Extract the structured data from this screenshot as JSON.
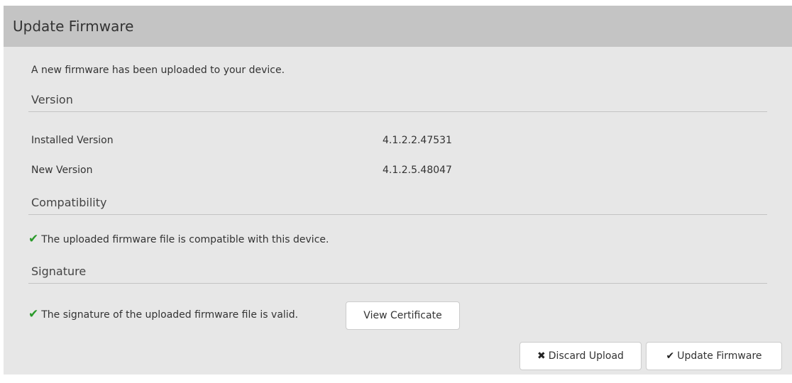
{
  "header": {
    "title": "Update Firmware"
  },
  "intro_text": "A new firmware has been uploaded to your device.",
  "version_section": {
    "heading": "Version",
    "rows": [
      {
        "label": "Installed Version",
        "value": "4.1.2.2.47531"
      },
      {
        "label": "New Version",
        "value": "4.1.2.5.48047"
      }
    ]
  },
  "compatibility_section": {
    "heading": "Compatibility",
    "status_text": "The uploaded firmware file is compatible with this device.",
    "status_icon": "check-icon"
  },
  "signature_section": {
    "heading": "Signature",
    "status_text": "The signature of the uploaded firmware file is valid.",
    "status_icon": "check-icon",
    "view_certificate_label": "View Certificate"
  },
  "actions": {
    "discard_label": "Discard Upload",
    "discard_icon": "x-icon",
    "update_label": "Update Firmware",
    "update_icon": "check-icon"
  },
  "colors": {
    "header_bg": "#c4c4c4",
    "panel_bg": "#e7e7e7",
    "check_green": "#2a9a2a"
  }
}
